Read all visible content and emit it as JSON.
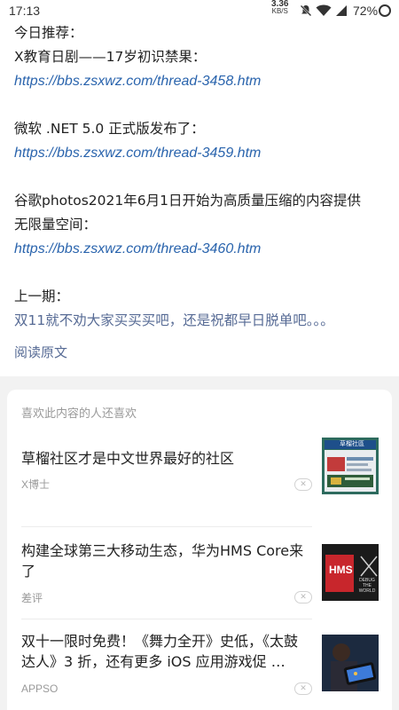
{
  "status_bar": {
    "time": "17:13",
    "net_speed_value": "3.36",
    "net_speed_unit": "KB/S",
    "battery": "72%"
  },
  "article": {
    "today_heading": "今日推荐：",
    "item1_title": "X教育日剧——17岁初识禁果：",
    "item1_link": "https://bbs.zsxwz.com/thread-3458.htm",
    "item2_title": "微软 .NET 5.0 正式版发布了：",
    "item2_link": "https://bbs.zsxwz.com/thread-3459.htm",
    "item3_title_line1": "谷歌photos2021年6月1日开始为高质量压缩的内容提供",
    "item3_title_line2": "无限量空间：",
    "item3_link": "https://bbs.zsxwz.com/thread-3460.htm",
    "prev_heading": "上一期：",
    "prev_link": "双11就不劝大家买买买吧，还是祝都早日脱单吧。。。",
    "read_original": "阅读原文"
  },
  "recommend": {
    "title": "喜欢此内容的人还喜欢",
    "items": [
      {
        "title": "草榴社区才是中文世界最好的社区",
        "source": "X博士",
        "thumb_text": "草榴社區"
      },
      {
        "title": "构建全球第三大移动生态，华为HMS Core来了",
        "source": "差评",
        "thumb_text": "HMS",
        "thumb_subtext": "DEBUG THE WORLD"
      },
      {
        "title": "双十一限时免费！《舞力全开》史低，《太鼓达人》3 折，还有更多 iOS 应用游戏促 …",
        "source": "APPSO"
      }
    ]
  },
  "colors": {
    "link": "#2a64ad",
    "wechat_link": "#576b95",
    "muted": "#9a9a9a",
    "bg_gray": "#f2f2f2"
  }
}
